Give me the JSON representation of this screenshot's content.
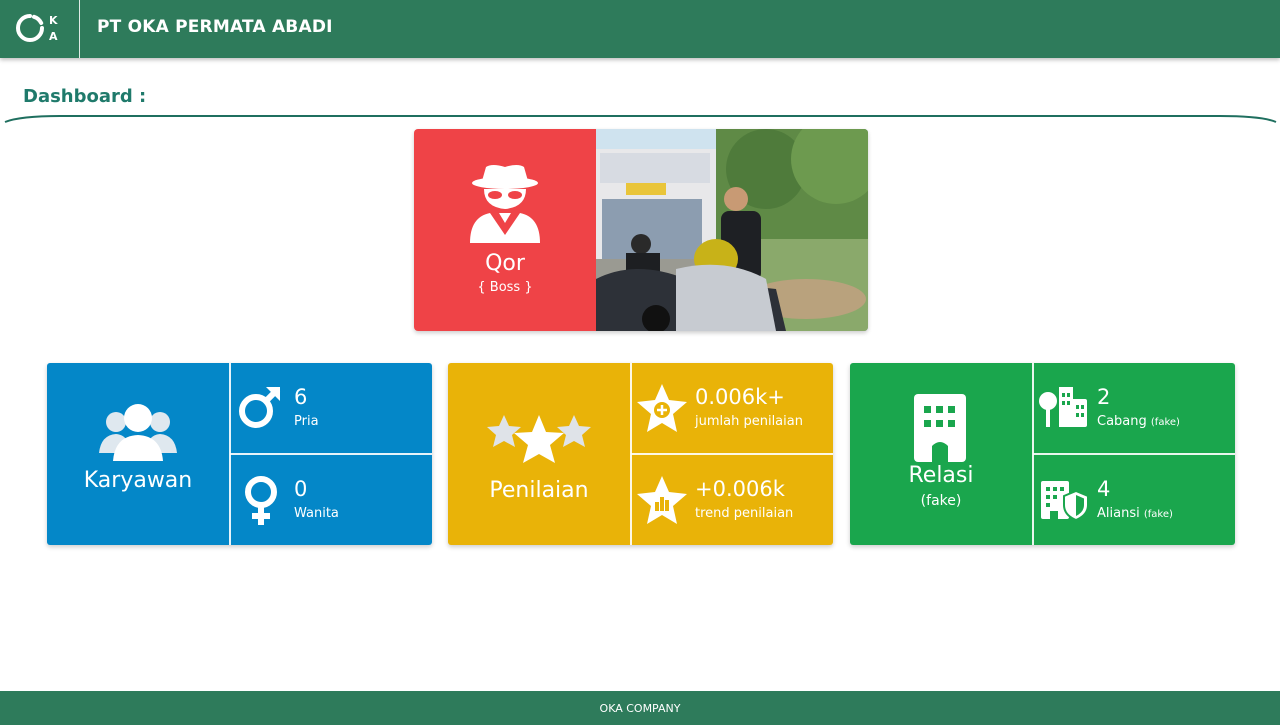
{
  "header": {
    "logo_text": "OKA",
    "title": "PT OKA PERMATA ABADI"
  },
  "dashboard": {
    "title": "Dashboard :"
  },
  "profile": {
    "name": "Qor",
    "role": "{ Boss }",
    "icon": "spy-icon",
    "accent": "#ef4347"
  },
  "cards": {
    "karyawan": {
      "label": "Karyawan",
      "icon": "users-icon",
      "color": "#0487c8",
      "male": {
        "value": "6",
        "label": "Pria",
        "icon": "male-icon"
      },
      "female": {
        "value": "0",
        "label": "Wanita",
        "icon": "female-icon"
      }
    },
    "penilaian": {
      "label": "Penilaian",
      "icon": "stars-icon",
      "color": "#e9b308",
      "count": {
        "value": "0.006k+",
        "label": "jumlah penilaian",
        "icon": "star-plus-icon"
      },
      "trend": {
        "value": "+0.006k",
        "label": "trend penilaian",
        "icon": "star-chart-icon"
      }
    },
    "relasi": {
      "label": "Relasi",
      "sublabel": "(fake)",
      "icon": "building-icon",
      "color": "#1aa64d",
      "cabang": {
        "value": "2",
        "label": "Cabang",
        "note": "(fake)",
        "icon": "city-icon"
      },
      "aliansi": {
        "value": "4",
        "label": "Aliansi",
        "note": "(fake)",
        "icon": "building-shield-icon"
      }
    }
  },
  "footer": {
    "text": "OKA COMPANY"
  }
}
